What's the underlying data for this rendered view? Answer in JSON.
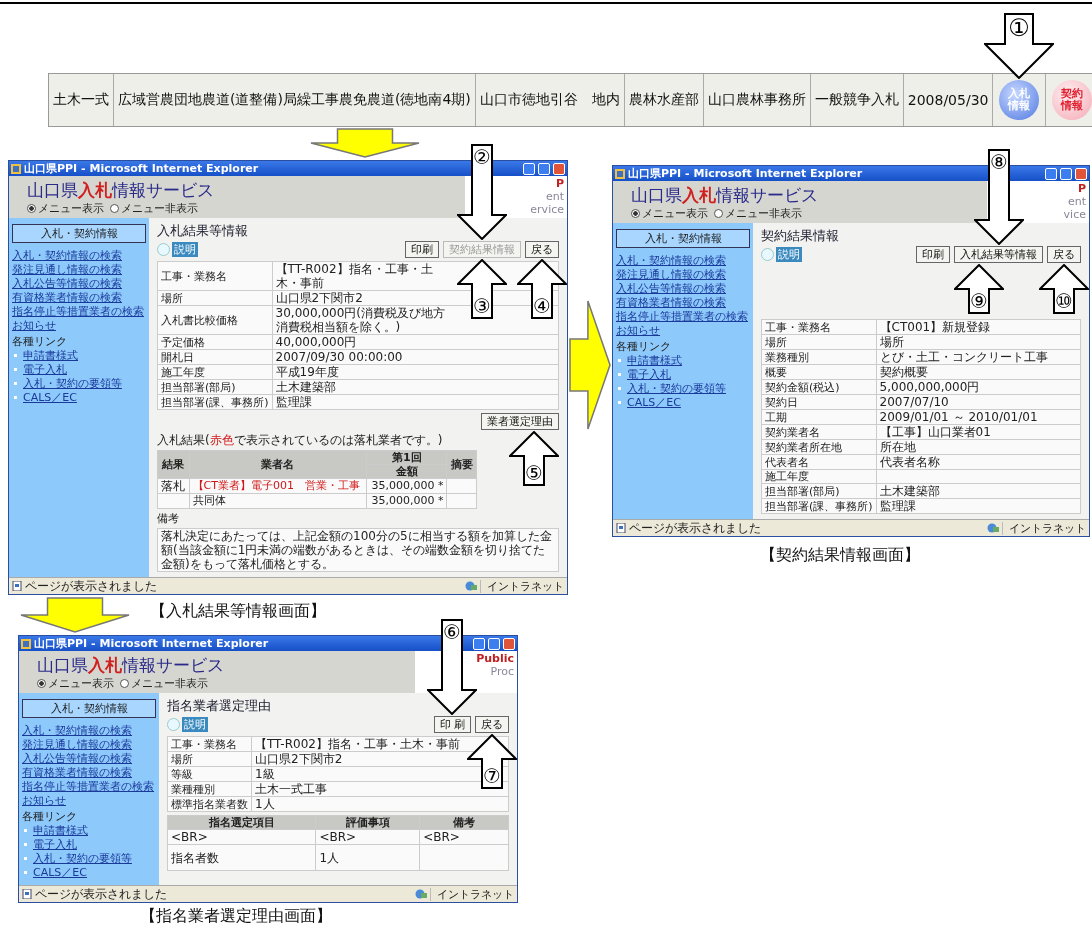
{
  "info_bar": {
    "cells": [
      "土木一式",
      "広域営農団地農道(道整備)局繰工事農免農道(徳地南4期)",
      "山口市徳地引谷　地内",
      "農林水産部",
      "山口農林事務所",
      "一般競争入札",
      "2008/05/30"
    ],
    "buttons": [
      {
        "kind": "bid",
        "label": "入札情報"
      },
      {
        "kind": "contract",
        "label": "契約情報"
      }
    ]
  },
  "screens": [
    {
      "caption": "【入札結果等情報画面】",
      "window": {
        "title": "山口県PPI - Microsoft Internet Explorer",
        "logo": "山口県**入札**情報サービス",
        "menu_options": [
          {
            "label": "メニュー表示",
            "selected": true
          },
          {
            "label": "メニュー非表示",
            "selected": false
          }
        ],
        "logo_fragments": [
          "P",
          "ent",
          "ervice"
        ],
        "sidebar": {
          "heading": "入札・契約情報",
          "links": [
            "入札・契約情報の検索",
            "発注見通し情報の検索",
            "入札公告等情報の検索",
            "有資格業者情報の検索",
            "指名停止等措置業者の検索",
            "お知らせ"
          ],
          "group_label": "各種リンク",
          "sub_links": [
            "申請書様式",
            "電子入札",
            "入札・契約の要領等",
            "CALS／EC"
          ]
        },
        "main": {
          "title": "入札結果等情報",
          "help_button": "説明",
          "blocks": [
            {
              "kind": "button_row",
              "buttons": [
                {
                  "label": "印刷",
                  "disabled": false
                },
                {
                  "label": "契約結果情報",
                  "disabled": true
                },
                {
                  "label": "戻る",
                  "disabled": false
                }
              ]
            },
            {
              "kind": "info_table",
              "rows": [
                {
                  "label": "工事・業務名",
                  "value": "【TT-R002】指名・工事・土木・事前"
                },
                {
                  "label": "場所",
                  "value": "山口県2下関市2"
                },
                {
                  "label": "入札書比較価格",
                  "value": "30,000,000円(消費税及び地方消費税相当額を除く。)"
                },
                {
                  "label": "予定価格",
                  "value": "40,000,000円"
                },
                {
                  "label": "開札日",
                  "value": "2007/09/30 00:00:00"
                },
                {
                  "label": "施工年度",
                  "value": "平成19年度"
                },
                {
                  "label": "担当部署(部局)",
                  "value": "土木建築部"
                },
                {
                  "label": "担当部署(課、事務所)",
                  "value": "監理課"
                }
              ]
            },
            {
              "kind": "button_row",
              "buttons": [
                {
                  "label": "業者選定理由",
                  "disabled": false
                }
              ]
            },
            {
              "kind": "note",
              "text": "入札結果(",
              "highlight": "赤色",
              "rest": "で表示されているのは落札業者です。)"
            },
            {
              "kind": "results_table",
              "columns": [
                "結果",
                "業者名",
                "第1回",
                "摘要"
              ],
              "subcolumn": "金額",
              "rows": [
                {
                  "result": "落札",
                  "name": "【CT業者】電子001　営業・工事",
                  "amount": "35,000,000 *",
                  "winner": true
                },
                {
                  "name": "共同体",
                  "amount": "35,000,000 *",
                  "winner": false
                }
              ]
            },
            {
              "kind": "remarks",
              "label": "備考",
              "text": "落札決定にあたっては、上記金額の100分の5に相当する額を加算した金額(当該金額に1円未満の端数があるときは、その端数金額を切り捨てた金額)をもって落札価格とする。"
            }
          ]
        },
        "status": {
          "text": "ページが表示されました",
          "zone": "イントラネット"
        }
      }
    },
    {
      "caption": "【契約結果情報画面】",
      "window": {
        "title": "山口県PPI - Microsoft Internet Explorer",
        "logo": "山口県**入札**情報サービス",
        "menu_options": [
          {
            "label": "メニュー表示",
            "selected": true
          },
          {
            "label": "メニュー非表示",
            "selected": false
          }
        ],
        "logo_fragments": [
          "P",
          "ent",
          "vice"
        ],
        "sidebar": {
          "heading": "入札・契約情報",
          "links": [
            "入札・契約情報の検索",
            "発注見通し情報の検索",
            "入札公告等情報の検索",
            "有資格業者情報の検索",
            "指名停止等措置業者の検索",
            "お知らせ"
          ],
          "group_label": "各種リンク",
          "sub_links": [
            "申請書様式",
            "電子入札",
            "入札・契約の要領等",
            "CALS／EC"
          ]
        },
        "main": {
          "title": "契約結果情報",
          "help_button": "説明",
          "blocks": [
            {
              "kind": "button_row",
              "buttons": [
                {
                  "label": "印刷",
                  "disabled": false
                },
                {
                  "label": "入札結果等情報",
                  "disabled": false
                },
                {
                  "label": "戻る",
                  "disabled": false
                }
              ]
            },
            {
              "kind": "info_table",
              "rows": [
                {
                  "label": "工事・業務名",
                  "value": "【CT001】新規登録"
                },
                {
                  "label": "場所",
                  "value": "場所"
                },
                {
                  "label": "業務種別",
                  "value": "とび・土工・コンクリート工事"
                },
                {
                  "label": "概要",
                  "value": "契約概要"
                },
                {
                  "label": "契約金額(税込)",
                  "value": "5,000,000,000円"
                },
                {
                  "label": "契約日",
                  "value": "2007/07/10"
                },
                {
                  "label": "工期",
                  "value": "2009/01/01 ～ 2010/01/01"
                },
                {
                  "label": "契約業者名",
                  "value": "【工事】山口業者01"
                },
                {
                  "label": "契約業者所在地",
                  "value": "所在地"
                },
                {
                  "label": "代表者名",
                  "value": "代表者名称"
                },
                {
                  "label": "施工年度"
                },
                {
                  "label": "担当部署(部局)",
                  "value": "土木建築部"
                },
                {
                  "label": "担当部署(課、事務所)",
                  "value": "監理課"
                }
              ]
            }
          ]
        },
        "status": {
          "text": "ページが表示されました",
          "zone": "イントラネット"
        }
      }
    },
    {
      "caption": "【指名業者選定理由画面】",
      "window": {
        "title": "山口県PPI - Microsoft Internet Explorer",
        "logo": "山口県**入札**情報サービス",
        "menu_options": [
          {
            "label": "メニュー表示",
            "selected": true
          },
          {
            "label": "メニュー非表示",
            "selected": false
          }
        ],
        "logo_fragments": [
          "Public",
          "Proc"
        ],
        "sidebar": {
          "heading": "入札・契約情報",
          "links": [
            "入札・契約情報の検索",
            "発注見通し情報の検索",
            "入札公告等情報の検索",
            "有資格業者情報の検索",
            "指名停止等措置業者の検索",
            "お知らせ"
          ],
          "group_label": "各種リンク",
          "sub_links": [
            "申請書様式",
            "電子入札",
            "入札・契約の要領等",
            "CALS／EC"
          ]
        },
        "main": {
          "title": "指名業者選定理由",
          "help_button": "説明",
          "blocks": [
            {
              "kind": "button_row",
              "buttons": [
                {
                  "label": "印 刷",
                  "disabled": false
                },
                {
                  "label": "戻る",
                  "disabled": false
                }
              ]
            },
            {
              "kind": "info_table",
              "rows": [
                {
                  "label": "工事・業務名",
                  "value": "【TT-R002】指名・工事・土木・事前"
                },
                {
                  "label": "場所",
                  "value": "山口県2下関市2"
                },
                {
                  "label": "等級",
                  "value": "1級"
                },
                {
                  "label": "業種種別",
                  "value": "土木一式工事"
                },
                {
                  "label": "標準指名業者数",
                  "value": "1人"
                }
              ]
            },
            {
              "kind": "grid_table",
              "columns": [
                "指名選定項目",
                "評価事項",
                "備考"
              ],
              "rows": [
                [
                  "<BR>",
                  "<BR>",
                  "<BR>"
                ],
                [
                  "指名者数",
                  "1人"
                ]
              ]
            }
          ]
        },
        "status": {
          "text": "ページが表示されました",
          "zone": "イントラネット"
        }
      }
    }
  ],
  "steps": [
    {
      "number": "①",
      "kind": "down"
    },
    {
      "number": "②",
      "kind": "down"
    },
    {
      "number": "③",
      "kind": "up"
    },
    {
      "number": "④",
      "kind": "up"
    },
    {
      "number": "⑤",
      "kind": "up"
    },
    {
      "number": "⑥",
      "kind": "down"
    },
    {
      "number": "⑦",
      "kind": "up"
    },
    {
      "number": "⑧",
      "kind": "down"
    },
    {
      "number": "⑨",
      "kind": "up"
    },
    {
      "number": "⑩",
      "kind": "up"
    }
  ]
}
